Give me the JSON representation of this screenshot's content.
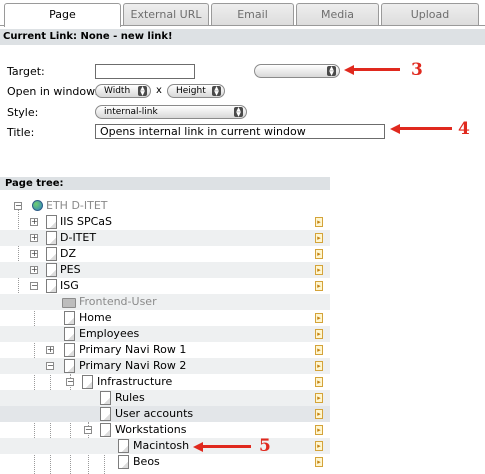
{
  "tabs": [
    {
      "label": "Page",
      "active": true
    },
    {
      "label": "External URL",
      "active": false
    },
    {
      "label": "Email",
      "active": false
    },
    {
      "label": "Media",
      "active": false
    },
    {
      "label": "Upload",
      "active": false
    }
  ],
  "current_link": "Current Link: None - new link!",
  "form": {
    "target_label": "Target:",
    "target_value": "",
    "target_select_value": "",
    "open_in_window_label": "Open in window:",
    "width_value": "Width",
    "x_sep": "x",
    "height_value": "Height",
    "style_label": "Style:",
    "style_value": "internal-link",
    "title_label": "Title:",
    "title_value": "Opens internal link in current window"
  },
  "callouts": [
    "3",
    "4",
    "5"
  ],
  "tree": {
    "header": "Page tree:",
    "nodes": [
      {
        "label": "ETH D-ITET",
        "icon": "globe-icon",
        "expander": "-",
        "grey": true,
        "go": false
      },
      {
        "label": "IIS SPCaS",
        "icon": "page-icon",
        "expander": "+",
        "grey": false,
        "go": true
      },
      {
        "label": "D-ITET",
        "icon": "page-icon",
        "expander": "+",
        "grey": false,
        "go": true
      },
      {
        "label": "DZ",
        "icon": "page-icon",
        "expander": "+",
        "grey": false,
        "go": true
      },
      {
        "label": "PES",
        "icon": "page-icon",
        "expander": "+",
        "grey": false,
        "go": true
      },
      {
        "label": "ISG",
        "icon": "page-icon",
        "expander": "-",
        "grey": false,
        "go": true
      },
      {
        "label": "Frontend-User",
        "icon": "folder-icon",
        "expander": "",
        "grey": true,
        "go": false
      },
      {
        "label": "Home",
        "icon": "page-icon",
        "expander": "",
        "grey": false,
        "go": true
      },
      {
        "label": "Employees",
        "icon": "page-icon",
        "expander": "",
        "grey": false,
        "go": true
      },
      {
        "label": "Primary Navi Row 1",
        "icon": "page-icon",
        "expander": "+",
        "grey": false,
        "go": true
      },
      {
        "label": "Primary Navi Row 2",
        "icon": "page-icon",
        "expander": "-",
        "grey": false,
        "go": true
      },
      {
        "label": "Infrastructure",
        "icon": "page-icon",
        "expander": "-",
        "grey": false,
        "go": true
      },
      {
        "label": "Rules",
        "icon": "page-icon",
        "expander": "",
        "grey": false,
        "go": true
      },
      {
        "label": "User accounts",
        "icon": "page-icon",
        "expander": "",
        "grey": false,
        "go": true
      },
      {
        "label": "Workstations",
        "icon": "page-icon",
        "expander": "-",
        "grey": false,
        "go": true
      },
      {
        "label": "Macintosh",
        "icon": "page-icon",
        "expander": "",
        "grey": false,
        "go": true
      },
      {
        "label": "Beos",
        "icon": "page-icon",
        "expander": "",
        "grey": false,
        "go": true
      }
    ]
  },
  "colors": {
    "accent": "#e0291e",
    "header_bg": "#dde1e4"
  }
}
